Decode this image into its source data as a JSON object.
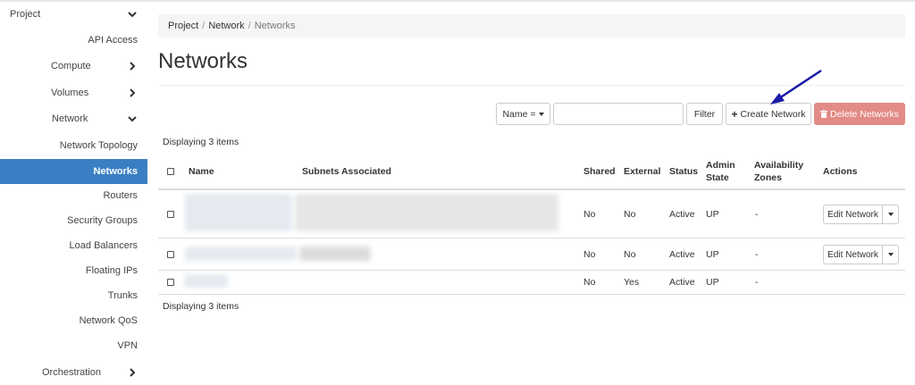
{
  "sidebar": {
    "items": [
      {
        "label": "Project",
        "kind": "category",
        "chevron": "down"
      },
      {
        "label": "API Access",
        "kind": "item"
      },
      {
        "label": "Compute",
        "kind": "sub",
        "chevron": "right"
      },
      {
        "label": "Volumes",
        "kind": "sub",
        "chevron": "right"
      },
      {
        "label": "Network",
        "kind": "sub",
        "chevron": "down"
      },
      {
        "label": "Network Topology",
        "kind": "item"
      },
      {
        "label": "Networks",
        "kind": "item",
        "active": true
      },
      {
        "label": "Routers",
        "kind": "item"
      },
      {
        "label": "Security Groups",
        "kind": "item"
      },
      {
        "label": "Load Balancers",
        "kind": "item"
      },
      {
        "label": "Floating IPs",
        "kind": "item"
      },
      {
        "label": "Trunks",
        "kind": "item"
      },
      {
        "label": "Network QoS",
        "kind": "item"
      },
      {
        "label": "VPN",
        "kind": "item"
      },
      {
        "label": "Orchestration",
        "kind": "sub",
        "chevron": "right"
      }
    ]
  },
  "breadcrumb": {
    "items": [
      "Project",
      "Network",
      "Networks"
    ],
    "separator": "/"
  },
  "page_title": "Networks",
  "toolbar": {
    "filter_field": "Name =",
    "search_value": "",
    "filter_label": "Filter",
    "create_label": "Create Network",
    "delete_label": "Delete Networks"
  },
  "displaying_top": "Displaying 3 items",
  "displaying_bottom": "Displaying 3 items",
  "table": {
    "headers": {
      "name": "Name",
      "subnets": "Subnets Associated",
      "shared": "Shared",
      "external": "External",
      "status": "Status",
      "admin_state_1": "Admin",
      "admin_state_2": "State",
      "az_1": "Availability",
      "az_2": "Zones",
      "actions": "Actions"
    },
    "rows": [
      {
        "shared": "No",
        "external": "No",
        "status": "Active",
        "admin_state": "UP",
        "az": "-",
        "action": "Edit Network"
      },
      {
        "shared": "No",
        "external": "No",
        "status": "Active",
        "admin_state": "UP",
        "az": "-",
        "action": "Edit Network"
      },
      {
        "shared": "No",
        "external": "Yes",
        "status": "Active",
        "admin_state": "UP",
        "az": "-",
        "action": ""
      }
    ]
  },
  "colors": {
    "active_nav": "#3a7fc3",
    "danger": "#e38b86",
    "annotation_arrow": "#1a1aa8"
  },
  "icons": {
    "create": "plus-icon",
    "delete": "trash-icon",
    "dropdown": "caret-down-icon"
  }
}
